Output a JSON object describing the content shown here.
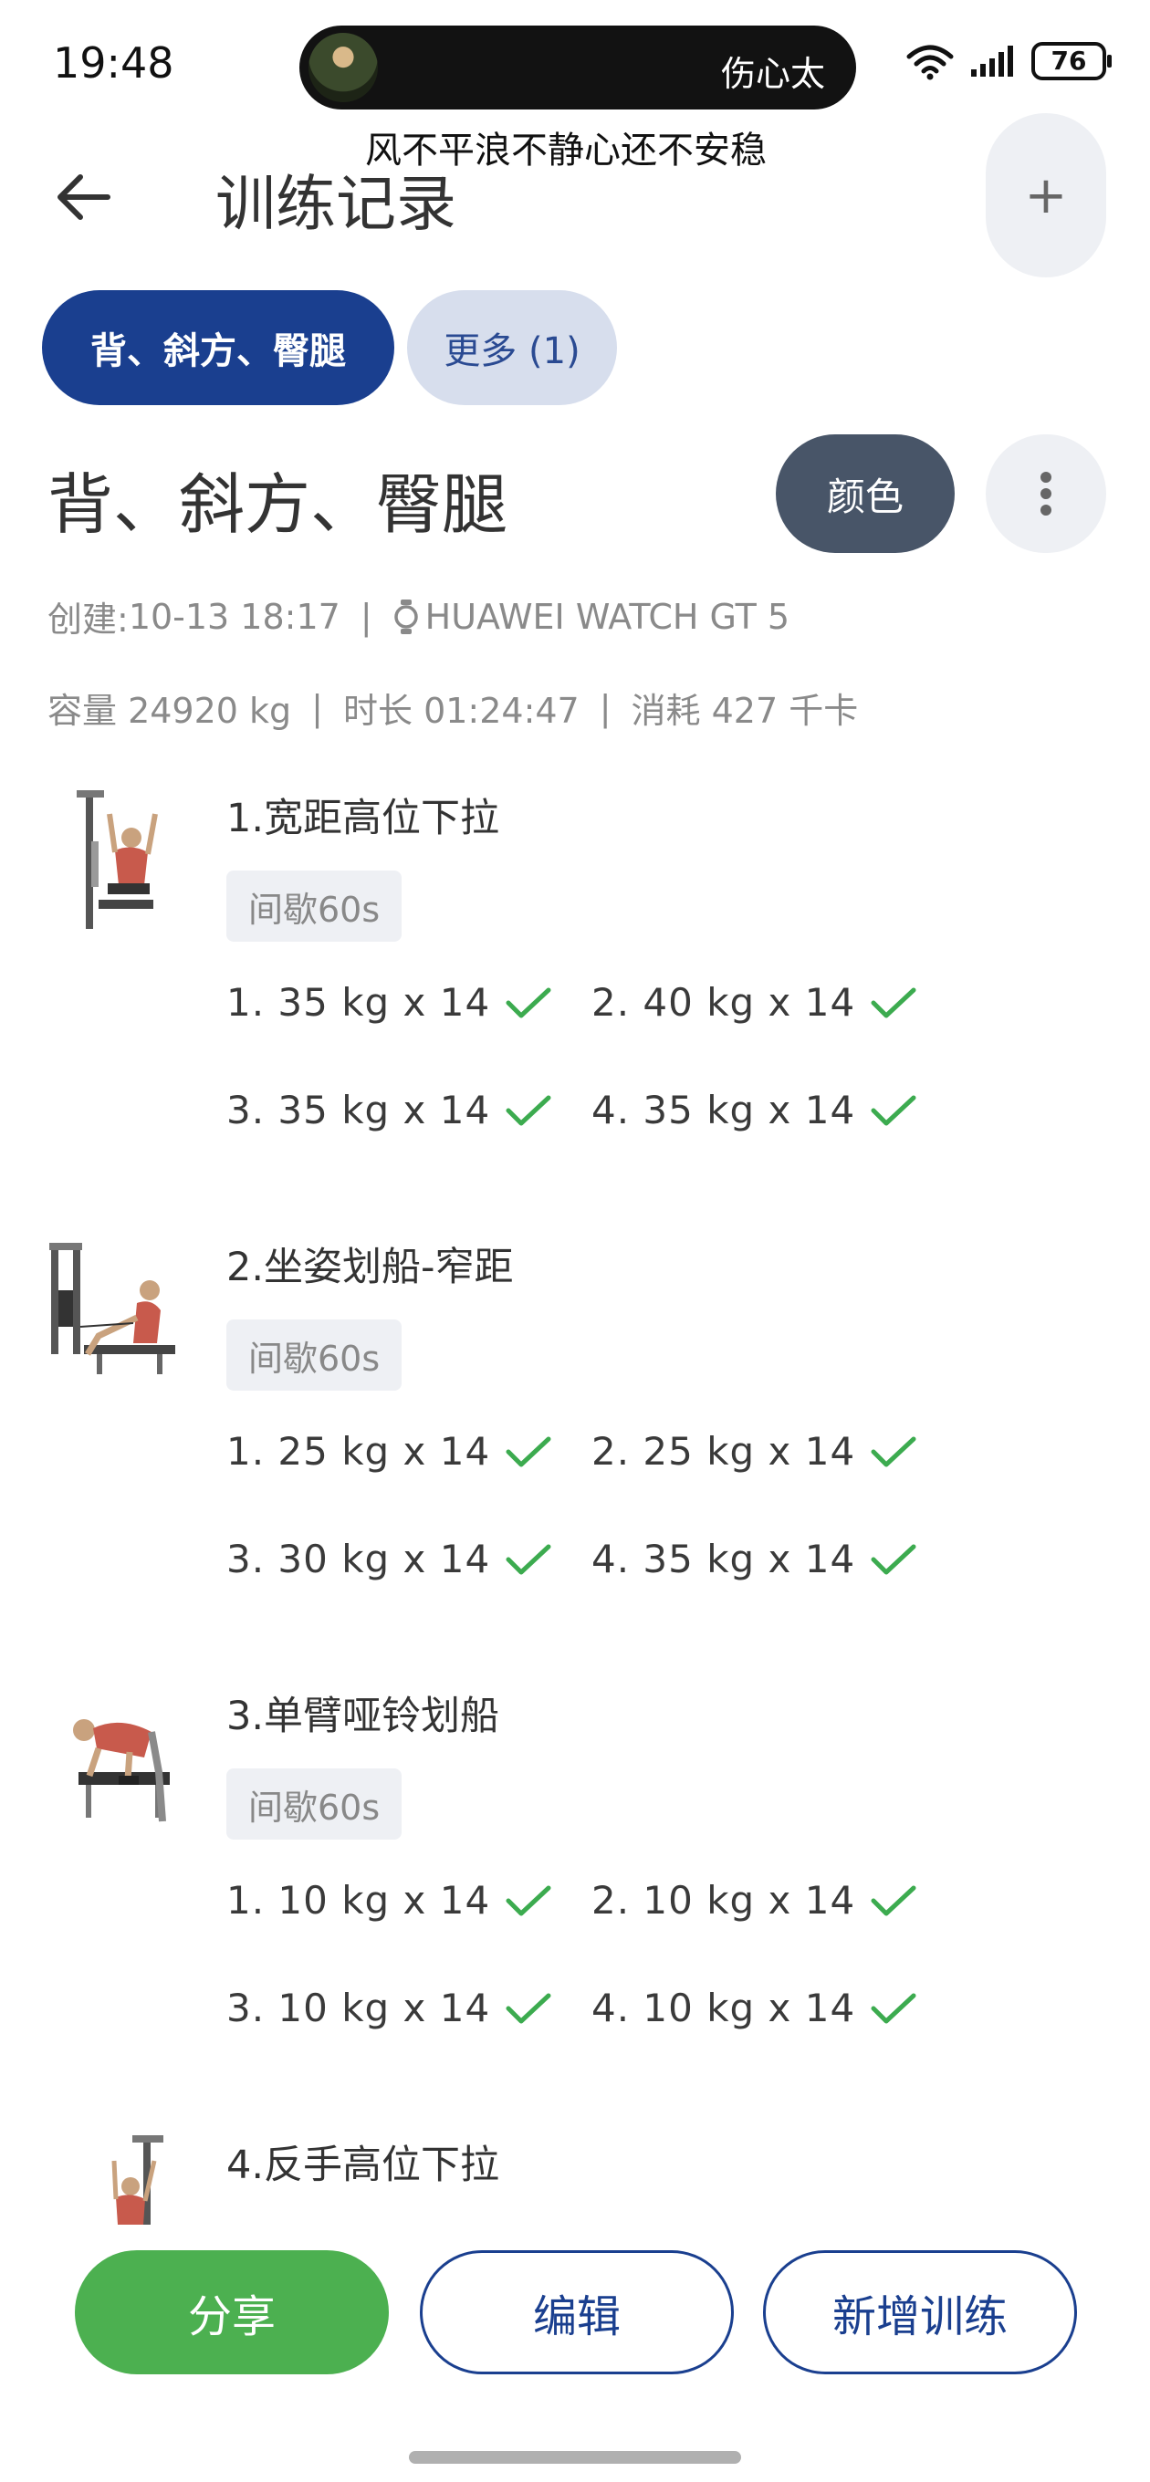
{
  "status_bar": {
    "time": "19:48",
    "island_name": "伤心太",
    "battery": "76",
    "lyric": "风不平浪不静心还不安稳"
  },
  "header": {
    "title": "训练记录",
    "add_label": "+"
  },
  "chips": {
    "active": "背、斜方、臀腿",
    "more": "更多 (1)"
  },
  "workout": {
    "title": "背、斜方、臀腿",
    "color_label": "颜色",
    "created_label": "创建: ",
    "created_value": "10-13 18:17",
    "device": "HUAWEI WATCH GT 5",
    "volume": "容量 24920 kg",
    "duration": "时长 01:24:47",
    "calories": "消耗 427 千卡"
  },
  "exercises": [
    {
      "name": "1.宽距高位下拉",
      "rest": "间歇60s",
      "sets": [
        "1. 35 kg x 14",
        "2. 40 kg x 14",
        "3. 35 kg x 14",
        "4. 35 kg x 14"
      ]
    },
    {
      "name": "2.坐姿划船-窄距",
      "rest": "间歇60s",
      "sets": [
        "1. 25 kg x 14",
        "2. 25 kg x 14",
        "3. 30 kg x 14",
        "4. 35 kg x 14"
      ]
    },
    {
      "name": "3.单臂哑铃划船",
      "rest": "间歇60s",
      "sets": [
        "1. 10 kg x 14",
        "2. 10 kg x 14",
        "3. 10 kg x 14",
        "4. 10 kg x 14"
      ]
    },
    {
      "name": "4.反手高位下拉"
    }
  ],
  "actions": {
    "share": "分享",
    "edit": "编辑",
    "new": "新增训练"
  },
  "colors": {
    "primary": "#1a3f8f",
    "success": "#4cb050",
    "check": "#3cab4f",
    "chip_bg": "#d7deed",
    "color_button": "#485568"
  }
}
